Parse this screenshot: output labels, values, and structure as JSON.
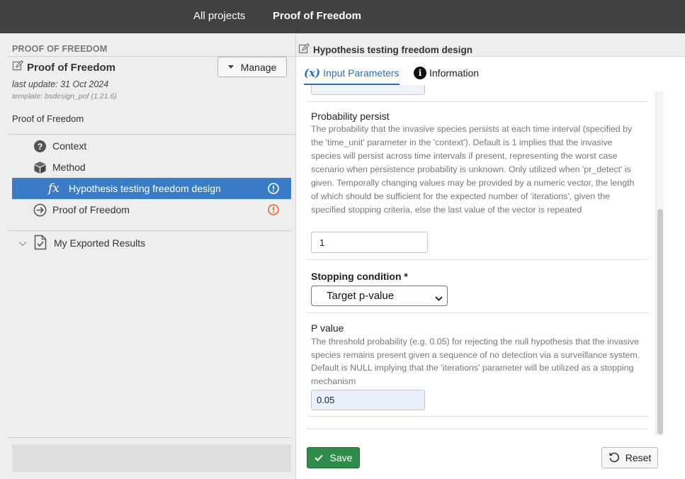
{
  "topbar": {
    "all_projects": "All projects",
    "current_project": "Proof of Freedom"
  },
  "sidebar": {
    "header": "PROOF OF FREEDOM",
    "project_title": "Proof of Freedom",
    "manage_label": "Manage",
    "last_update": "last update: 31 Oct 2024",
    "template": "template: bsdesign_pof (1.21.6)",
    "description": "Proof of Freedom",
    "items": [
      {
        "label": "Context",
        "icon": "question-circle-icon"
      },
      {
        "label": "Method",
        "icon": "cube-icon"
      },
      {
        "label": "Hypothesis testing freedom design",
        "icon": "function-icon",
        "active": true,
        "warning": true
      },
      {
        "label": "Proof of Freedom",
        "icon": "arrow-circle-icon",
        "warning": true
      }
    ],
    "exported": {
      "label": "My Exported Results",
      "icon": "document-check-icon"
    }
  },
  "panel": {
    "title": "Hypothesis testing freedom design",
    "tabs": [
      {
        "label": "Input Parameters",
        "icon_text": "(x)",
        "active": true
      },
      {
        "label": "Information",
        "icon_text": "i"
      }
    ],
    "fields": {
      "persist": {
        "label": "Probability persist",
        "description": "The probability that the invasive species persists at each time interval (specified by the 'time_unit' parameter in the 'context'). Default is 1 implies that the invasive species will persist across time intervals if present, representing the worst case scenario when persistence probability is unknown. Only utilized when 'pr_detect' is given. Temporally changing values may be provided by a numeric vector, the length of which should be sufficient for the expected number of 'iterations', given the specified stopping criteria, else the last value of the vector is repeated",
        "value": "1"
      },
      "stopping": {
        "label": "Stopping condition",
        "required_mark": "*",
        "value": "Target p-value"
      },
      "pvalue": {
        "label": "P value",
        "description": "The threshold probability (e.g. 0.05) for rejecting the null hypothesis that the invasive species remains present given a sequence of no detection via a surveillance system. Default is NULL implying that the 'iterations' parameter will be utilized as a stopping mechanism",
        "value": "0.05"
      }
    },
    "save_label": "Save",
    "reset_label": "Reset"
  },
  "colors": {
    "topbar": "#414141",
    "active_item": "#3a7cc5",
    "tab_accent": "#2d6db3",
    "warning": "#e8622c",
    "save": "#2e8b4a"
  }
}
